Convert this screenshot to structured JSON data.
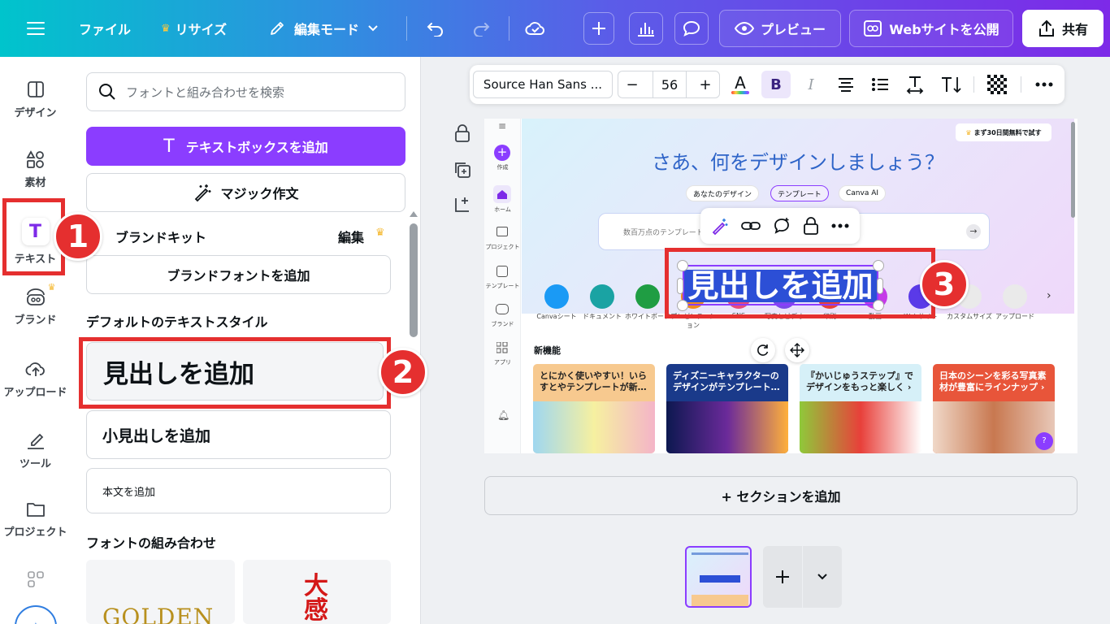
{
  "topbar": {
    "file": "ファイル",
    "resize": "リサイズ",
    "edit_mode": "編集モード",
    "preview": "プレビュー",
    "publish": "Webサイトを公開",
    "share": "共有"
  },
  "rail": {
    "items": [
      {
        "label": "デザイン"
      },
      {
        "label": "素材"
      },
      {
        "label": "テキスト"
      },
      {
        "label": "ブランド"
      },
      {
        "label": "アップロード"
      },
      {
        "label": "ツール"
      },
      {
        "label": "プロジェクト"
      }
    ]
  },
  "panel": {
    "search_placeholder": "フォントと組み合わせを検索",
    "add_textbox": "テキストボックスを追加",
    "magic_write": "マジック作文",
    "brand_kit": "ブランドキット",
    "brand_edit": "編集",
    "add_brand_font": "ブランドフォントを追加",
    "default_styles": "デフォルトのテキストスタイル",
    "add_heading": "見出しを追加",
    "add_subheading": "小見出しを追加",
    "add_body": "本文を追加",
    "font_combos": "フォントの組み合わせ",
    "combo1": "GOLDEN",
    "combo2": "大感"
  },
  "annotations": {
    "n1": "1",
    "n2": "2",
    "n3": "3"
  },
  "format_toolbar": {
    "font": "Source Han Sans ...",
    "minus": "−",
    "size": "56",
    "plus": "+",
    "bold": "B",
    "italic": "I"
  },
  "design": {
    "trial": "まず30日間無料で試す",
    "title": "さあ、何をデザインしましょう？",
    "tabs": [
      "あなたのデザイン",
      "テンプレート",
      "Canva AI"
    ],
    "search_placeholder": "数百万点のテンプレート",
    "selected_text": "見出しを追加",
    "side": [
      "作成",
      "ホーム",
      "プロジェクト",
      "テンプレート",
      "ブランド",
      "アプリ"
    ],
    "categories": [
      "Canvaシート",
      "ドキュメント",
      "ホワイトボード",
      "プレゼンテーション",
      "SNS",
      "写真とビデオ",
      "印刷",
      "動画",
      "Webサイト",
      "カスタムサイズ",
      "アップロード"
    ],
    "whats_new": "新機能",
    "cards": [
      "とにかく使いやすい！いらすとやテンプレートが新…",
      "ディズニーキャラクターのデザインがテンプレート…",
      "『かいじゅうステップ』でデザインをもっと楽しく ›",
      "日本のシーンを彩る写真素材が豊富にラインナップ ›"
    ],
    "help": "?"
  },
  "add_section": "+ セクションを追加",
  "colors": {
    "accent": "#7d2ae8",
    "red": "#e52f2f",
    "select": "#2c4fd6"
  }
}
